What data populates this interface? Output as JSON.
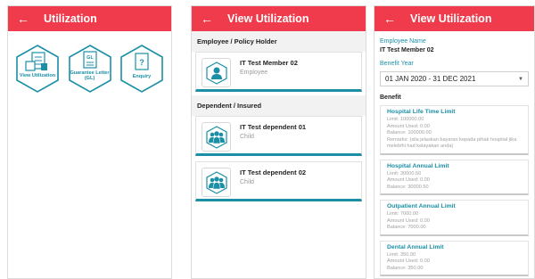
{
  "screen1": {
    "title": "Utilization",
    "back_glyph": "←",
    "buttons": [
      {
        "label": "View Utilization",
        "icon": "documents-icon"
      },
      {
        "label": "Guarantee Letter (GL)",
        "icon": "gl-document-icon",
        "doc_text": "GL"
      },
      {
        "label": "Enquiry",
        "icon": "question-document-icon",
        "doc_text": "?"
      }
    ]
  },
  "screen2": {
    "title": "View Utilization",
    "back_glyph": "←",
    "employee_section": "Employee / Policy Holder",
    "employee": {
      "name": "IT Test Member 02",
      "role": "Employee"
    },
    "dependent_section": "Dependent / Insured",
    "dependents": [
      {
        "name": "IT Test dependent 01",
        "role": "Child"
      },
      {
        "name": "IT Test dependent 02",
        "role": "Child"
      }
    ]
  },
  "screen3": {
    "title": "View Utilization",
    "back_glyph": "←",
    "employee_label": "Employee Name",
    "employee_value": "IT Test Member 02",
    "year_label": "Benefit Year",
    "year_value": "01 JAN 2020 - 31 DEC 2021",
    "caret": "▼",
    "benefit_heading": "Benefit",
    "benefits": [
      {
        "title": "Hospital Life Time Limit",
        "lines": [
          "Limit: 100000.00",
          "Amount Used: 0.00",
          "Balance: 100000.00",
          "Remarks: (sila jelaskan bayaran kepada pihak hospital jika melebihi had kelayakan anda)"
        ]
      },
      {
        "title": "Hospital Annual Limit",
        "lines": [
          "Limit: 30000.50",
          "Amount Used: 0.00",
          "Balance: 30000.50"
        ]
      },
      {
        "title": "Outpatient Annual Limit",
        "lines": [
          "Limit: 7000.00",
          "Amount Used: 0.00",
          "Balance: 7000.00"
        ]
      },
      {
        "title": "Dental Annual Limit",
        "lines": [
          "Limit: 350.00",
          "Amount Used: 0.00",
          "Balance: 350.00"
        ]
      }
    ]
  },
  "colors": {
    "header": "#ef3b4b",
    "accent": "#1a8fa6"
  }
}
